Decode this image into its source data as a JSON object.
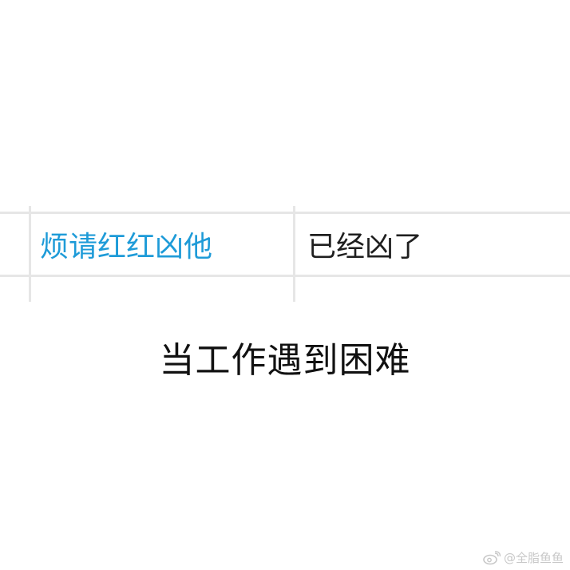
{
  "table": {
    "cell_left": "烦请红红凶他",
    "cell_right": "已经凶了"
  },
  "caption": "当工作遇到困难",
  "watermark": {
    "icon": "weibo-icon",
    "text": "@全脂鱼鱼"
  },
  "colors": {
    "link_blue": "#1e9bd8",
    "grid_gray": "#e6e6e6",
    "watermark_gray": "#c8c8c8"
  }
}
